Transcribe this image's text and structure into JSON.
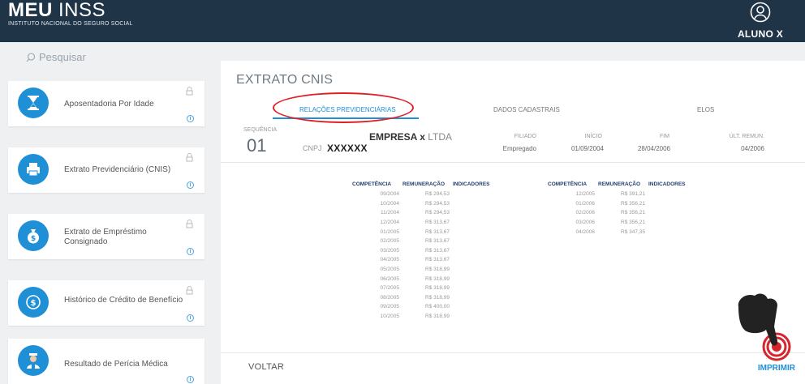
{
  "header": {
    "logo_main_bold": "MEU",
    "logo_main_light": "INSS",
    "logo_sub": "INSTITUTO NACIONAL DO SEGURO SOCIAL",
    "user_name": "ALUNO X"
  },
  "search": {
    "placeholder": "Pesquisar"
  },
  "services": [
    {
      "title": "Aposentadoria Por Idade",
      "icon": "hourglass-icon"
    },
    {
      "title": "Extrato Previdenciário (CNIS)",
      "icon": "printer-icon"
    },
    {
      "title": "Extrato de Empréstimo Consignado",
      "icon": "money-bag-icon"
    },
    {
      "title": "Histórico de Crédito de Benefício",
      "icon": "dollar-coin-icon"
    },
    {
      "title": "Resultado de Perícia Médica",
      "icon": "doctor-icon"
    }
  ],
  "panel": {
    "title": "EXTRATO CNIS",
    "tabs": [
      "RELAÇÕES PREVIDENCIÁRIAS",
      "DADOS CADASTRAIS",
      "ELOS"
    ],
    "sequencia_label": "SEQUÊNCIA",
    "sequencia": "01",
    "empresa_bold": "EMPRESA x",
    "empresa_light": "LTDA",
    "cnpj_label": "CNPJ",
    "cnpj": "XXXXXX",
    "filiado_label": "FILIADO",
    "filiado": "Empregado",
    "inicio_label": "INÍCIO",
    "inicio": "01/09/2004",
    "fim_label": "FIM",
    "fim": "28/04/2006",
    "ult_remun_label": "ÚLT. REMUN.",
    "ult_remun": "04/2006"
  },
  "table": {
    "headers": [
      "COMPETÊNCIA",
      "REMUNERAÇÃO",
      "INDICADORES"
    ],
    "left_rows": [
      [
        "09/2004",
        "R$ 294,53"
      ],
      [
        "10/2004",
        "R$ 294,53"
      ],
      [
        "11/2004",
        "R$ 294,53"
      ],
      [
        "12/2004",
        "R$ 313,67"
      ],
      [
        "01/2005",
        "R$ 313,67"
      ],
      [
        "02/2005",
        "R$ 313,67"
      ],
      [
        "03/2005",
        "R$ 313,67"
      ],
      [
        "04/2005",
        "R$ 313,67"
      ],
      [
        "05/2005",
        "R$ 318,99"
      ],
      [
        "06/2005",
        "R$ 318,99"
      ],
      [
        "07/2005",
        "R$ 318,99"
      ],
      [
        "08/2005",
        "R$ 318,99"
      ],
      [
        "09/2005",
        "R$ 400,00"
      ],
      [
        "10/2005",
        "R$ 318,99"
      ]
    ],
    "right_rows": [
      [
        "12/2005",
        "R$ 391,21"
      ],
      [
        "01/2006",
        "R$ 356,21"
      ],
      [
        "02/2006",
        "R$ 356,21"
      ],
      [
        "03/2006",
        "R$ 356,21"
      ],
      [
        "04/2006",
        "R$ 347,35"
      ]
    ]
  },
  "footer": {
    "voltar": "VOLTAR",
    "imprimir": "IMPRIMIR"
  },
  "colors": {
    "header_bg": "#1f3447",
    "accent": "#1f8fd6",
    "highlight": "#e02027"
  }
}
